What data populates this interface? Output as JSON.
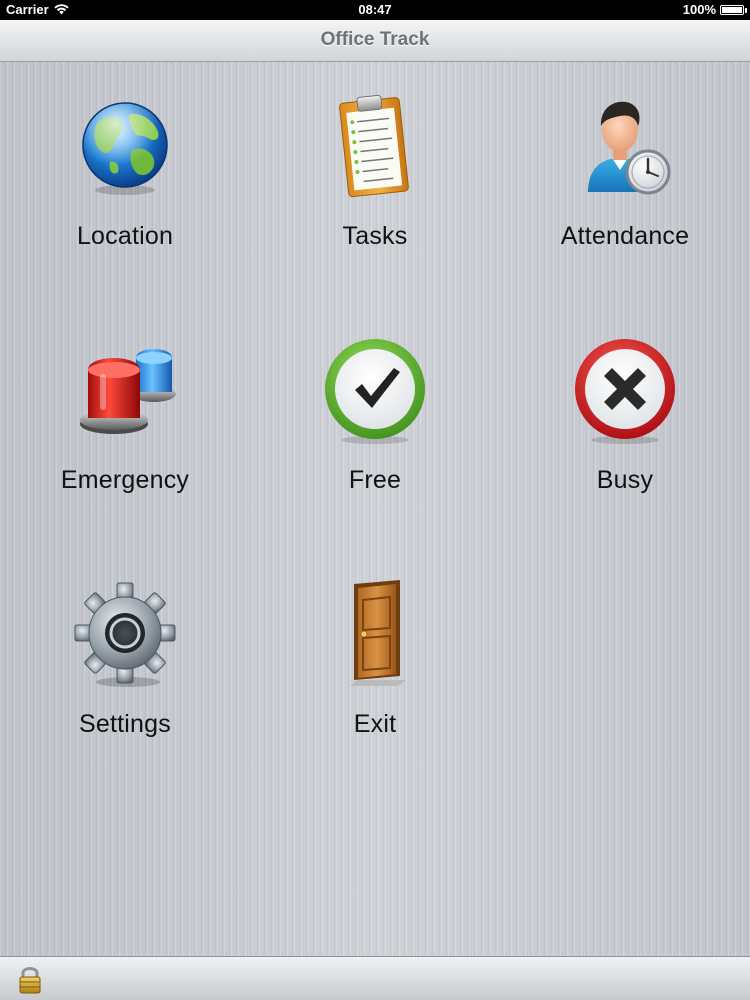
{
  "status_bar": {
    "carrier": "Carrier",
    "time": "08:47",
    "battery": "100%",
    "battery_level": 1.0
  },
  "nav": {
    "title": "Office Track"
  },
  "grid": {
    "items": [
      {
        "label": "Location",
        "icon": "globe-icon"
      },
      {
        "label": "Tasks",
        "icon": "clipboard-icon"
      },
      {
        "label": "Attendance",
        "icon": "person-clock-icon"
      },
      {
        "label": "Emergency",
        "icon": "siren-icon"
      },
      {
        "label": "Free",
        "icon": "check-icon"
      },
      {
        "label": "Busy",
        "icon": "x-icon"
      },
      {
        "label": "Settings",
        "icon": "gear-icon"
      },
      {
        "label": "Exit",
        "icon": "door-icon"
      }
    ]
  },
  "toolbar": {
    "icon": "lock-icon"
  },
  "colors": {
    "background": "#c9ccd3",
    "title_text": "#6f7378",
    "free_green": "#4caf2a",
    "busy_red": "#c8141c"
  }
}
